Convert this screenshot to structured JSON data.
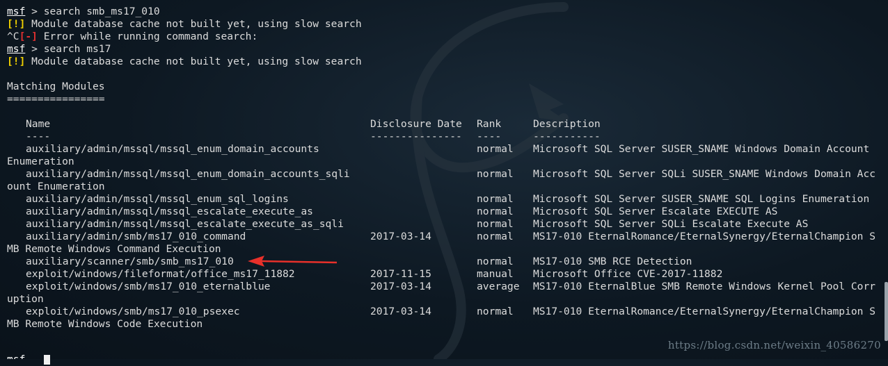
{
  "terminal": {
    "prompt": "msf",
    "lines": [
      {
        "type": "cmd",
        "text": " > search smb_ms17_010"
      },
      {
        "type": "warn",
        "tag": "[!]",
        "text": " Module database cache not built yet, using slow search"
      },
      {
        "type": "err",
        "pre": "^C",
        "tag": "[-]",
        "text": " Error while running command search:"
      },
      {
        "type": "cmd",
        "text": " > search ms17"
      },
      {
        "type": "warn",
        "tag": "[!]",
        "text": " Module database cache not built yet, using slow search"
      }
    ],
    "section_title": "Matching Modules",
    "section_rule": "================",
    "headers": {
      "name": "Name",
      "date": "Disclosure Date",
      "rank": "Rank",
      "desc": "Description"
    },
    "header_rules": {
      "name": "----",
      "date": "---------------",
      "rank": "----",
      "desc": "-----------"
    },
    "modules": [
      {
        "name": "auxiliary/admin/mssql/mssql_enum_domain_accounts",
        "date": "",
        "rank": "normal",
        "desc": "Microsoft SQL Server SUSER_SNAME Windows Domain Account",
        "wrap": "Enumeration"
      },
      {
        "name": "auxiliary/admin/mssql/mssql_enum_domain_accounts_sqli",
        "date": "",
        "rank": "normal",
        "desc": "Microsoft SQL Server SQLi SUSER_SNAME Windows Domain Acc",
        "wrap": "ount Enumeration"
      },
      {
        "name": "auxiliary/admin/mssql/mssql_enum_sql_logins",
        "date": "",
        "rank": "normal",
        "desc": "Microsoft SQL Server SUSER_SNAME SQL Logins Enumeration",
        "wrap": ""
      },
      {
        "name": "auxiliary/admin/mssql/mssql_escalate_execute_as",
        "date": "",
        "rank": "normal",
        "desc": "Microsoft SQL Server Escalate EXECUTE AS",
        "wrap": ""
      },
      {
        "name": "auxiliary/admin/mssql/mssql_escalate_execute_as_sqli",
        "date": "",
        "rank": "normal",
        "desc": "Microsoft SQL Server SQLi Escalate Execute AS",
        "wrap": ""
      },
      {
        "name": "auxiliary/admin/smb/ms17_010_command",
        "date": "2017-03-14",
        "rank": "normal",
        "desc": "MS17-010 EternalRomance/EternalSynergy/EternalChampion S",
        "wrap": "MB Remote Windows Command Execution"
      },
      {
        "name": "auxiliary/scanner/smb/smb_ms17_010",
        "date": "",
        "rank": "normal",
        "desc": "MS17-010 SMB RCE Detection",
        "wrap": ""
      },
      {
        "name": "exploit/windows/fileformat/office_ms17_11882",
        "date": "2017-11-15",
        "rank": "manual",
        "desc": "Microsoft Office CVE-2017-11882",
        "wrap": ""
      },
      {
        "name": "exploit/windows/smb/ms17_010_eternalblue",
        "date": "2017-03-14",
        "rank": "average",
        "desc": "MS17-010 EternalBlue SMB Remote Windows Kernel Pool Corr",
        "wrap": "uption"
      },
      {
        "name": "exploit/windows/smb/ms17_010_psexec",
        "date": "2017-03-14",
        "rank": "normal",
        "desc": "MS17-010 EternalRomance/EternalSynergy/EternalChampion S",
        "wrap": "MB Remote Windows Code Execution"
      }
    ],
    "bottom_prompt": "msf"
  },
  "watermark": "https://blog.csdn.net/weixin_40586270",
  "colors": {
    "warn": "#f0d000",
    "error": "#e03030",
    "arrow": "#e8302a",
    "background": "#0d1822"
  },
  "icons": {
    "arrow": "red-arrow-annotation",
    "dragon": "kali-dragon-watermark"
  }
}
